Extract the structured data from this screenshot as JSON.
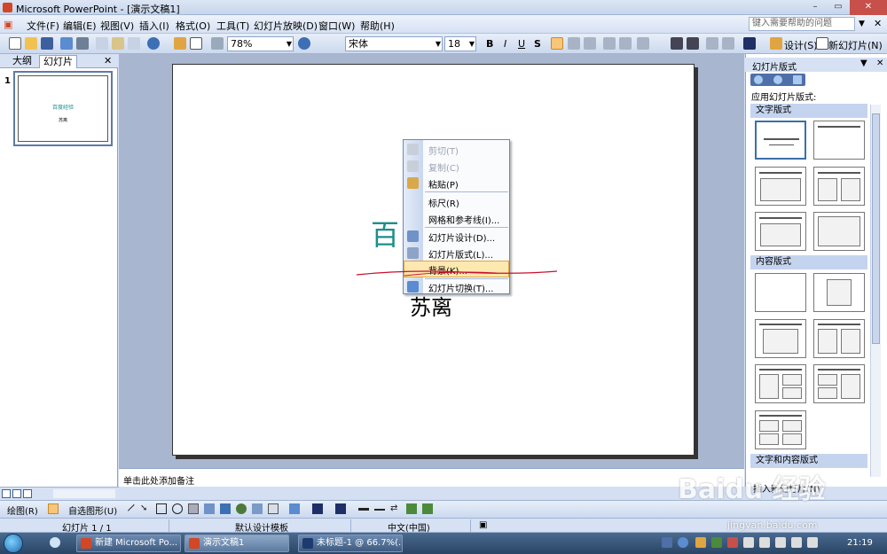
{
  "window": {
    "title": "Microsoft PowerPoint - [演示文稿1]",
    "controls": [
      "–",
      "▭",
      "✕"
    ]
  },
  "menubar": {
    "items": [
      "文件(F)",
      "编辑(E)",
      "视图(V)",
      "插入(I)",
      "格式(O)",
      "工具(T)",
      "幻灯片放映(D)",
      "窗口(W)",
      "帮助(H)"
    ],
    "help_placeholder": "键入需要帮助的问题"
  },
  "toolbar": {
    "zoom": "78%",
    "font": "宋体",
    "font_size": "18",
    "bold": "B",
    "italic": "I",
    "underline": "U",
    "shadow": "S",
    "design_label": "设计(S)",
    "new_slide_label": "新幻灯片(N)"
  },
  "left_pane": {
    "tabs": [
      "大纲",
      "幻灯片"
    ],
    "slide_number": "1",
    "thumb_title": "百度经验",
    "thumb_subtitle": "苏离"
  },
  "slide": {
    "title": "百",
    "subtitle": "苏离"
  },
  "context_menu": {
    "items": [
      {
        "label": "剪切(T)",
        "icon": "scissors-icon",
        "disabled": true
      },
      {
        "label": "复制(C)",
        "icon": "copy-icon",
        "disabled": true
      },
      {
        "label": "粘贴(P)",
        "icon": "paste-icon",
        "disabled": false
      },
      {
        "label": "标尺(R)",
        "icon": "",
        "disabled": false
      },
      {
        "label": "网格和参考线(I)...",
        "icon": "",
        "disabled": false
      },
      {
        "label": "幻灯片设计(D)...",
        "icon": "slide-design-icon",
        "disabled": false
      },
      {
        "label": "幻灯片版式(L)...",
        "icon": "slide-layout-icon",
        "disabled": false
      },
      {
        "label": "背景(K)...",
        "icon": "",
        "disabled": false,
        "highlighted": true
      },
      {
        "label": "幻灯片切换(T)...",
        "icon": "slide-transition-icon",
        "disabled": false
      }
    ]
  },
  "notes": {
    "placeholder": "单击此处添加备注"
  },
  "task_pane": {
    "title": "幻灯片版式",
    "apply_label": "应用幻灯片版式:",
    "sections": [
      "文字版式",
      "内容版式",
      "文字和内容版式"
    ],
    "insert_label": "插入新幻灯片(N)"
  },
  "drawing_toolbar": {
    "draw_label": "绘图(R)",
    "autoshapes_label": "自选图形(U)"
  },
  "statusbar": {
    "slide_info": "幻灯片 1 / 1",
    "template": "默认设计模板",
    "language": "中文(中国)"
  },
  "taskbar": {
    "buttons": [
      "新建 Microsoft Po...",
      "演示文稿1",
      "未标题-1 @ 66.7%(..."
    ],
    "clock": "21:19"
  },
  "watermark": {
    "brand": "Baidu 经验",
    "url": "jingyan.baidu.com"
  },
  "colors": {
    "title_teal": "#1c8e8c",
    "highlight": "#fde8b0",
    "annotation_red": "#c8102e"
  }
}
